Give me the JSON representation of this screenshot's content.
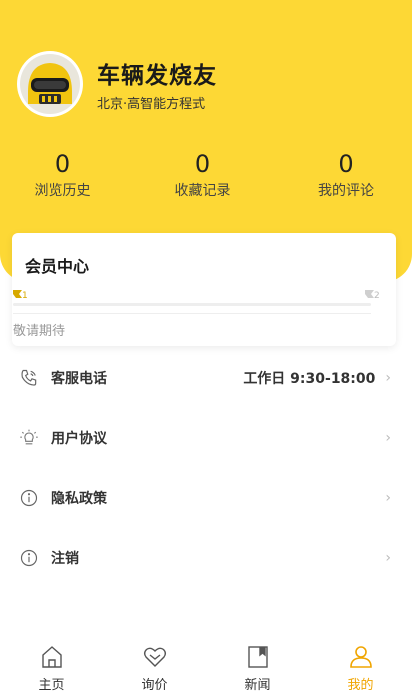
{
  "profile": {
    "username": "车辆发烧友",
    "location": "北京·高智能方程式"
  },
  "stats": [
    {
      "value": "0",
      "label": "浏览历史"
    },
    {
      "value": "0",
      "label": "收藏记录"
    },
    {
      "value": "0",
      "label": "我的评论"
    }
  ],
  "member": {
    "title": "会员中心",
    "level_current": "1",
    "level_next": "2",
    "status": "敬请期待",
    "progress": 0
  },
  "menu": [
    {
      "label": "客服电话",
      "value": "工作日 9:30-18:00",
      "icon": "phone-icon"
    },
    {
      "label": "用户协议",
      "icon": "sun-icon"
    },
    {
      "label": "隐私政策",
      "icon": "info-icon"
    },
    {
      "label": "注销",
      "icon": "info-icon"
    }
  ],
  "tabs": [
    {
      "label": "主页",
      "icon": "home-icon"
    },
    {
      "label": "询价",
      "icon": "heart-icon"
    },
    {
      "label": "新闻",
      "icon": "bookmark-icon"
    },
    {
      "label": "我的",
      "icon": "person-icon",
      "active": true
    }
  ],
  "colors": {
    "accent": "#fdd835",
    "tab_active": "#f0a500"
  }
}
